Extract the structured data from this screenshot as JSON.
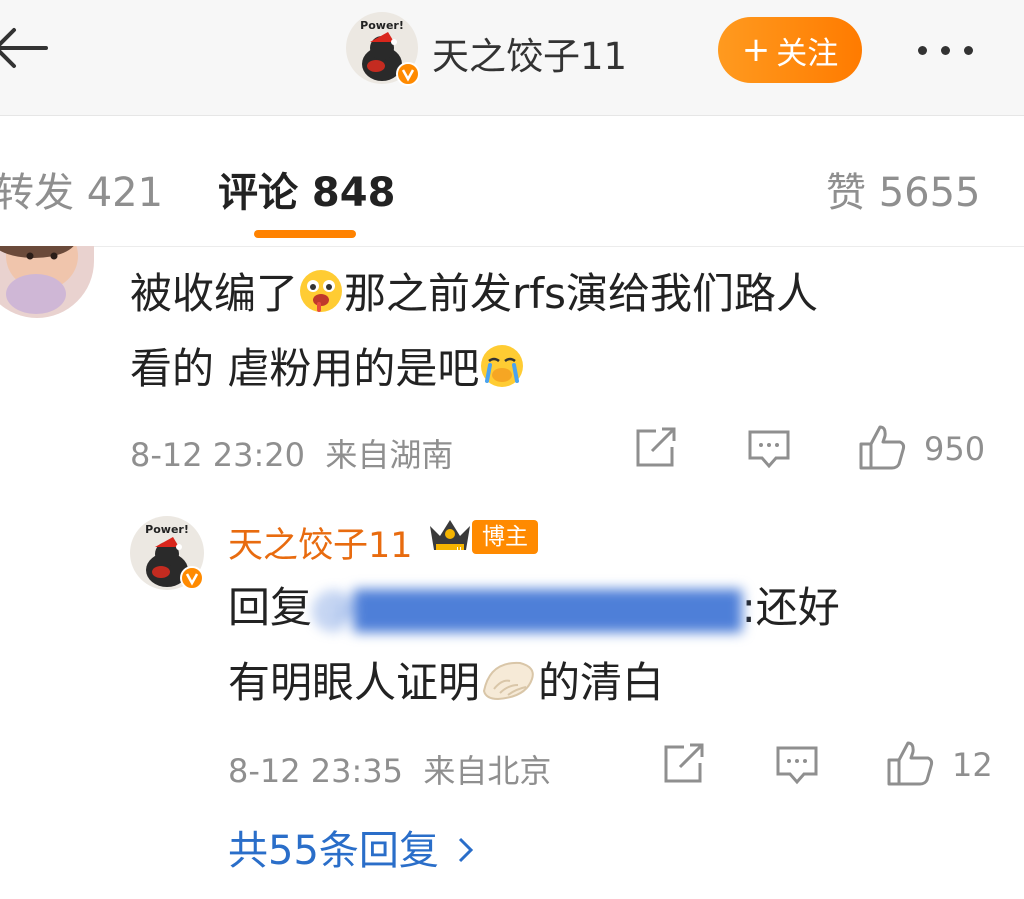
{
  "header": {
    "author_name": "天之饺子11",
    "follow_label": "关注",
    "avatar_text": "Power!"
  },
  "tabs": [
    {
      "label": "转发 421"
    },
    {
      "label": "评论 848"
    },
    {
      "label": "赞 5655"
    }
  ],
  "comment": {
    "text_line1_a": "被收编了",
    "text_line1_b": "那之前发rfs演给我们路人",
    "text_line2": "看的 虐粉用的是吧",
    "time": "8-12 23:20",
    "location": "来自湖南",
    "like_count": "950"
  },
  "reply": {
    "author": "天之饺子11",
    "badge": "博主",
    "prefix": "回复",
    "mention": "@▇▇▇▇▇▇▇▇▇▇▇▇",
    "after_mention": ":还好",
    "line2_a": "有明眼人证明",
    "line2_b": "的清白",
    "time": "8-12 23:35",
    "location": "来自北京",
    "like_count": "12"
  },
  "more_replies": "共55条回复",
  "colors": {
    "accent": "#ff8200",
    "link": "#2a6ec9",
    "author": "#e86b0f"
  }
}
